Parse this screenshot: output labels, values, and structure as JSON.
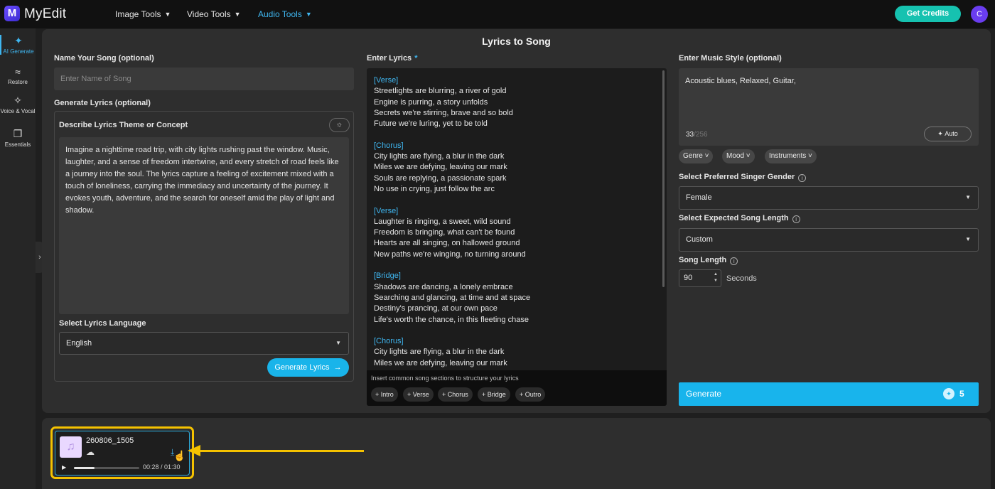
{
  "header": {
    "logo_letter": "M",
    "brand": "MyEdit",
    "nav": [
      {
        "label": "Image Tools"
      },
      {
        "label": "Video Tools"
      },
      {
        "label": "Audio Tools"
      }
    ],
    "active_nav": "Audio Tools",
    "get_credits": "Get Credits",
    "avatar_letter": "C",
    "accent": "#3fb6f0"
  },
  "sidebar": {
    "items": [
      {
        "label": "AI Generate",
        "icon": "magic-wand-icon"
      },
      {
        "label": "Restore",
        "icon": "waveform-icon"
      },
      {
        "label": "Voice & Vocal",
        "icon": "voice-wand-icon"
      },
      {
        "label": "Essentials",
        "icon": "copy-icon"
      }
    ],
    "active": "AI Generate"
  },
  "main": {
    "title": "Lyrics to Song",
    "song_name": {
      "label": "Name Your Song (optional)",
      "placeholder": "Enter Name of Song"
    },
    "generate_lyrics": {
      "section_label": "Generate Lyrics (optional)",
      "theme_label": "Describe Lyrics Theme or Concept",
      "theme_text": "Imagine a nighttime road trip, with city lights rushing past the window. Music, laughter, and a sense of freedom intertwine, and every stretch of road feels like a journey into the soul. The lyrics capture a feeling of excitement mixed with a touch of loneliness, carrying the immediacy and uncertainty of the journey. It evokes youth, adventure, and the search for oneself amid the play of light and shadow.",
      "language_label": "Select Lyrics Language",
      "language_value": "English",
      "button": "Generate Lyrics"
    },
    "lyrics": {
      "label": "Enter Lyrics",
      "required_mark": "*",
      "text": "[Verse]\nStreetlights are blurring, a river of gold\nEngine is purring, a story unfolds\nSecrets we're stirring, brave and so bold\nFuture we're luring, yet to be told\n\n[Chorus]\nCity lights are flying, a blur in the dark\nMiles we are defying, leaving our mark\nSouls are replying, a passionate spark\nNo use in crying, just follow the arc\n\n[Verse]\nLaughter is ringing, a sweet, wild sound\nFreedom is bringing, what can't be found\nHearts are all singing, on hallowed ground\nNew paths we're winging, no turning around\n\n[Bridge]\nShadows are dancing, a lonely embrace\nSearching and glancing, at time and at space\nDestiny's prancing, at our own pace\nLife's worth the chance, in this fleeting chase\n\n[Chorus]\nCity lights are flying, a blur in the dark\nMiles we are defying, leaving our mark",
      "insert_hint": "Insert common song sections to structure your lyrics",
      "chips": [
        "+ Intro",
        "+ Verse",
        "+ Chorus",
        "+ Bridge",
        "+ Outro"
      ]
    },
    "music_style": {
      "label": "Enter Music Style (optional)",
      "value": "Acoustic blues, Relaxed, Guitar,",
      "count": "33",
      "max": "/256",
      "auto": "Auto",
      "pills": [
        "Genre",
        "Mood",
        "Instruments"
      ]
    },
    "singer_gender": {
      "label": "Select Preferred Singer Gender",
      "value": "Female"
    },
    "song_length": {
      "label": "Select Expected Song Length",
      "value": "Custom"
    },
    "length": {
      "label": "Song Length",
      "value": "90",
      "unit": "Seconds"
    },
    "generate": {
      "label": "Generate",
      "cost": "5"
    }
  },
  "tray": {
    "song_name": "260806_1505",
    "time": "00:28 / 01:30",
    "progress": 0.31,
    "highlight_color": "#f5c200"
  }
}
